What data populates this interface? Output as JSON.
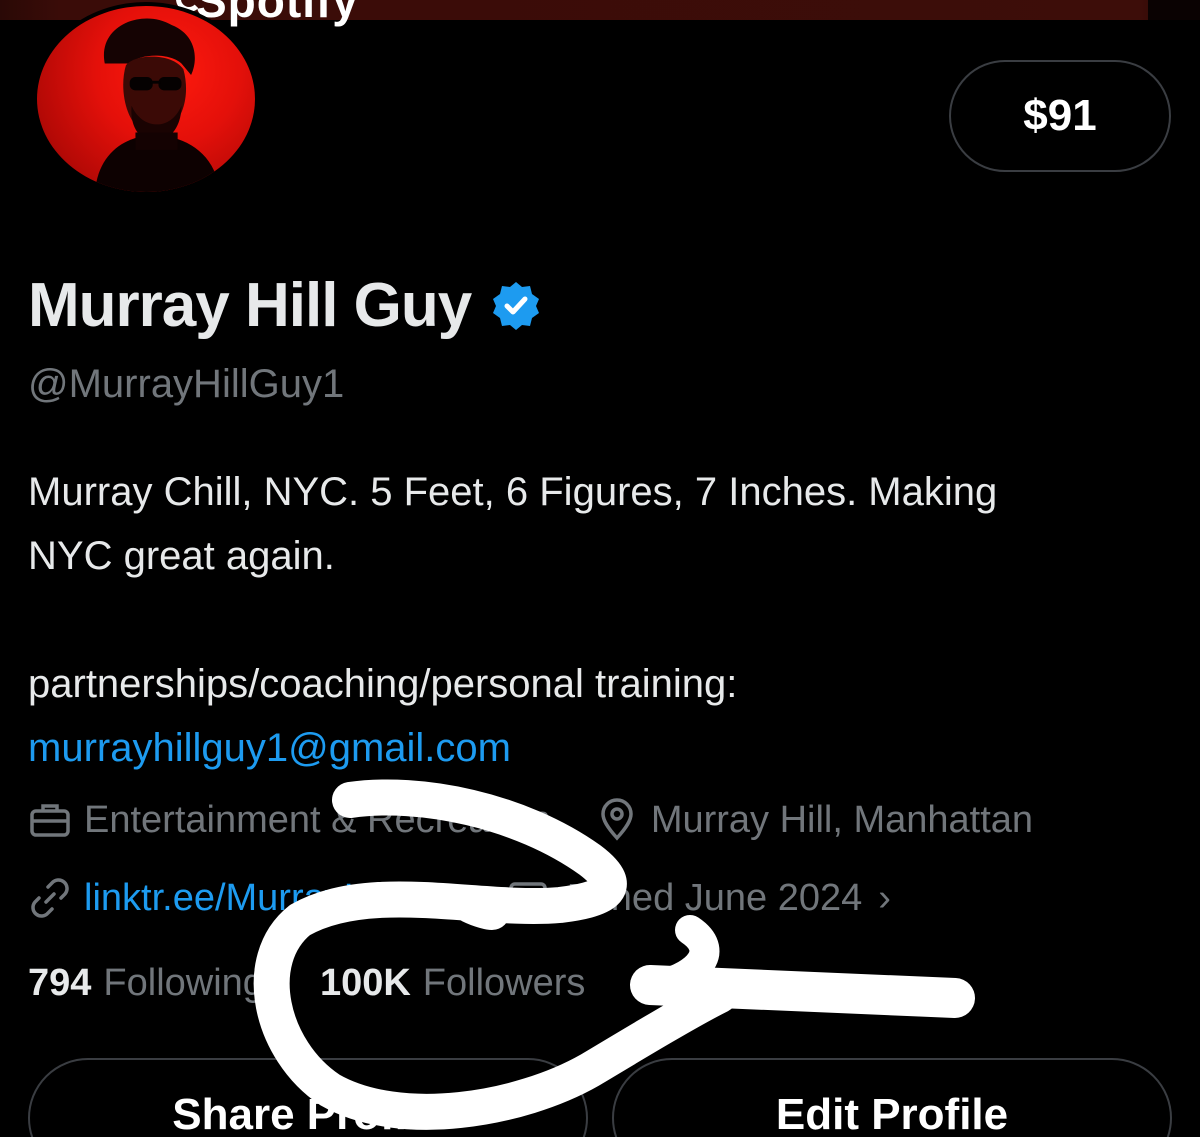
{
  "banner": {
    "brand_text": "Spotify"
  },
  "tip_button": {
    "label": "$91"
  },
  "profile": {
    "display_name": "Murray Hill Guy",
    "handle": "@MurrayHillGuy1",
    "bio_line1": "Murray Chill, NYC. 5 Feet, 6 Figures, 7 Inches. Making",
    "bio_line2": "NYC great again.",
    "bio_partner": "partnerships/coaching/personal training:",
    "bio_email": "murrayhillguy1@gmail.com"
  },
  "meta": {
    "category": "Entertainment & Recreation",
    "location": "Murray Hill, Manhattan",
    "website": "linktr.ee/MurrayHillGuy",
    "joined": "Joined June 2024"
  },
  "stats": {
    "following_count": "794",
    "following_label": "Following",
    "followers_count": "100K",
    "followers_label": "Followers"
  },
  "actions": {
    "share_label": "Share Profile",
    "edit_label": "Edit Profile"
  },
  "colors": {
    "background": "#000000",
    "link": "#1d9bf0",
    "muted": "#71767b",
    "text": "#e7e9ea",
    "verified": "#1d9bf0",
    "avatar_red": "#e4100a"
  }
}
